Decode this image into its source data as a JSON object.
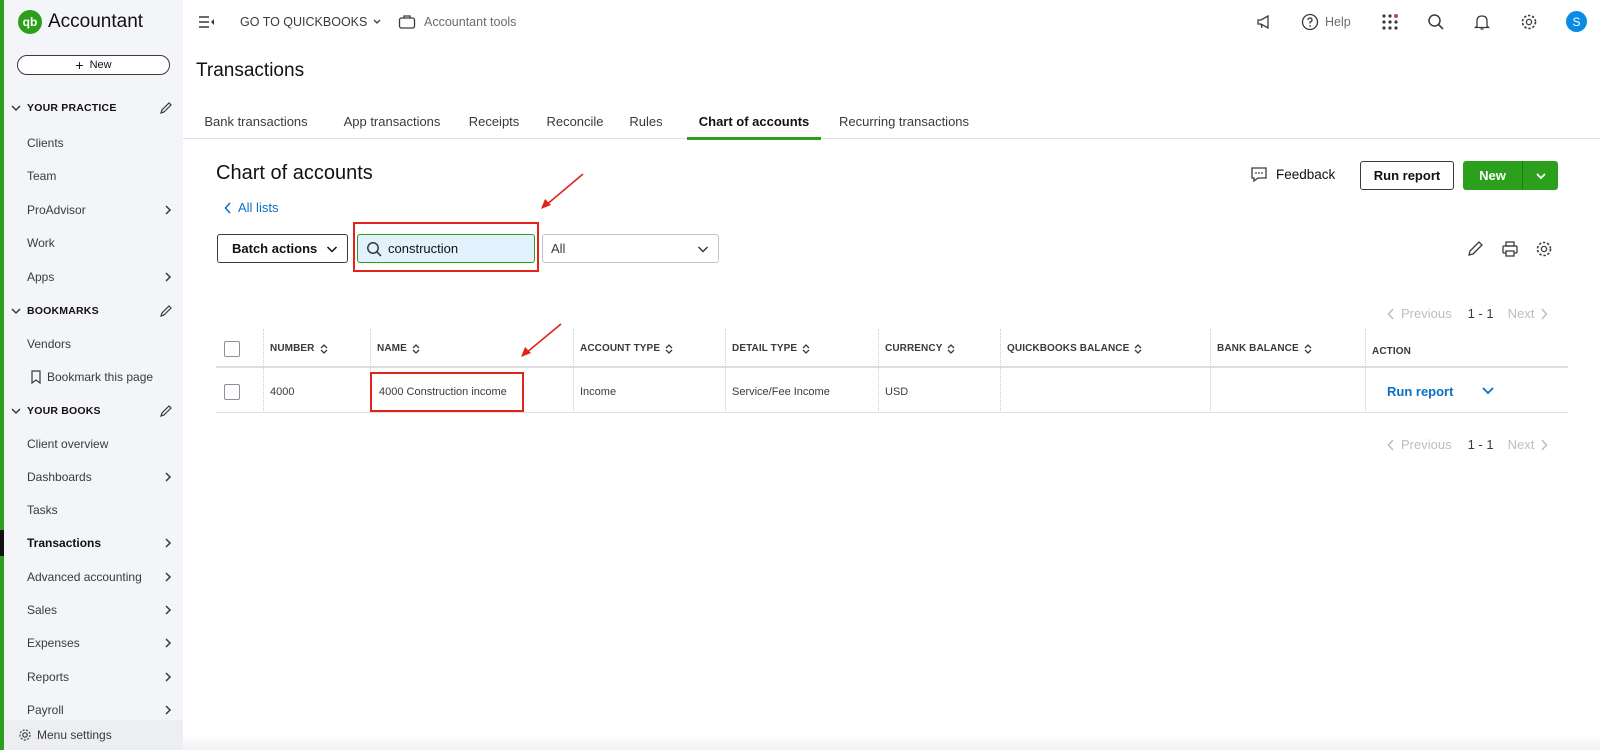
{
  "app": {
    "logo_mark": "qb",
    "logo_text": "Accountant"
  },
  "sidebar": {
    "new_label": "New",
    "sections": {
      "practice": "YOUR PRACTICE",
      "bookmarks": "BOOKMARKS",
      "books": "YOUR BOOKS"
    },
    "practice_items": [
      "Clients",
      "Team",
      "ProAdvisor",
      "Work",
      "Apps"
    ],
    "bookmark_items": [
      "Vendors",
      "Bookmark this page"
    ],
    "books_items": [
      "Client overview",
      "Dashboards",
      "Tasks",
      "Transactions",
      "Advanced accounting",
      "Sales",
      "Expenses",
      "Reports",
      "Payroll"
    ],
    "menu_settings": "Menu settings"
  },
  "topbar": {
    "goto_qb": "GO TO QUICKBOOKS",
    "accountant_tools": "Accountant tools",
    "help": "Help",
    "avatar_initial": "S"
  },
  "page": {
    "title": "Transactions"
  },
  "tabs": [
    "Bank transactions",
    "App transactions",
    "Receipts",
    "Reconcile",
    "Rules",
    "Chart of accounts",
    "Recurring transactions"
  ],
  "coa": {
    "title": "Chart of accounts",
    "all_lists": "All lists",
    "feedback": "Feedback",
    "run_report": "Run report",
    "new": "New",
    "batch_actions": "Batch actions",
    "search_value": "construction",
    "filter_value": "All"
  },
  "pager": {
    "previous": "Previous",
    "range": "1 - 1",
    "next": "Next"
  },
  "table": {
    "headers": [
      "NUMBER",
      "NAME",
      "ACCOUNT TYPE",
      "DETAIL TYPE",
      "CURRENCY",
      "QUICKBOOKS BALANCE",
      "BANK BALANCE",
      "ACTION"
    ],
    "rows": [
      {
        "number": "4000",
        "name": "4000 Construction income",
        "account_type": "Income",
        "detail_type": "Service/Fee Income",
        "currency": "USD",
        "qb_balance": "",
        "bank_balance": "",
        "action": "Run report"
      }
    ]
  },
  "colors": {
    "brand_green": "#2ca01c",
    "link_blue": "#0d6fc4",
    "annotation_red": "#e2231a"
  }
}
